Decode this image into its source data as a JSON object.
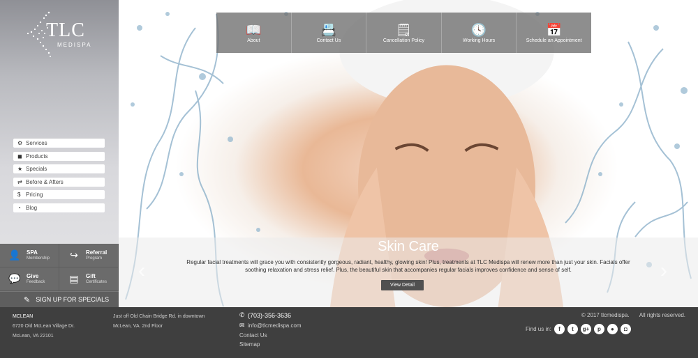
{
  "logo": {
    "brand": "TLC",
    "sub": "MEDISPA"
  },
  "sidebar": {
    "menu": [
      {
        "label": "Services",
        "icon": "gear-icon"
      },
      {
        "label": "Products",
        "icon": "cube-icon"
      },
      {
        "label": "Specials",
        "icon": "star-icon"
      },
      {
        "label": "Before & Afters",
        "icon": "refresh-icon"
      },
      {
        "label": "Pricing",
        "icon": "dollar-icon"
      },
      {
        "label": "Blog",
        "icon": "rss-icon"
      }
    ],
    "quick": [
      {
        "title": "SPA",
        "sub": "Membership",
        "icon": "user-add-icon"
      },
      {
        "title": "Referral",
        "sub": "Program",
        "icon": "share-icon"
      },
      {
        "title": "Give",
        "sub": "Feedback",
        "icon": "chat-icon"
      },
      {
        "title": "Gift",
        "sub": "Certificates",
        "icon": "certificate-icon"
      }
    ],
    "signup": "SIGN UP FOR SPECIALS"
  },
  "topnav": [
    {
      "label": "About",
      "icon": "book-icon"
    },
    {
      "label": "Contact Us",
      "icon": "contact-card-icon"
    },
    {
      "label": "Cancellation Policy",
      "icon": "policy-icon"
    },
    {
      "label": "Working Hours",
      "icon": "clock-icon"
    },
    {
      "label": "Schedule an Appointment",
      "icon": "calendar-icon"
    }
  ],
  "slide": {
    "title": "Skin Care",
    "text": "Regular facial treatments will grace you with consistently gorgeous, radiant, healthy, glowing skin! Plus, treatments at TLC Medispa will renew more than just your skin. Facials offer soothing relaxation and stress relief. Plus, the beautiful skin that accompanies regular facials improves confidence and sense of self.",
    "button": "View Detail"
  },
  "footer": {
    "location": {
      "city": "MCLEAN",
      "street": "6720 Old McLean Village Dr.",
      "citystate": "McLean, VA 22101"
    },
    "directions": {
      "line1": "Just off Old Chain Bridge Rd. in downtown",
      "line2": "McLean, VA. 2nd Floor"
    },
    "phone": "(703)-356-3636",
    "email": "info@tlcmedispa.com",
    "contact": "Contact Us",
    "sitemap": "Sitemap",
    "copyright": "© 2017 tlcmedispa.",
    "rights": "All rights reserved.",
    "find_us": "Find us in:",
    "social": [
      "facebook-icon",
      "twitter-icon",
      "google-plus-icon",
      "pinterest-icon",
      "map-pin-icon",
      "instagram-icon"
    ]
  }
}
